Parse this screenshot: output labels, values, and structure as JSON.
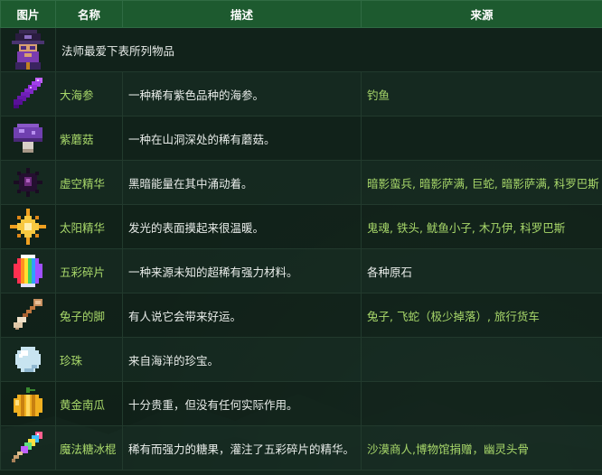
{
  "table": {
    "headers": {
      "image": "图片",
      "name": "名称",
      "description": "描述",
      "source": "来源"
    },
    "intro": {
      "icon": "wizard-portrait-icon",
      "text": "法师最爱下表所列物品"
    },
    "rows": [
      {
        "icon": "sea-cucumber-icon",
        "name": "大海参",
        "description": "一种稀有紫色品种的海参。",
        "source": "钓鱼"
      },
      {
        "icon": "purple-mushroom-icon",
        "name": "紫蘑菇",
        "description": "一种在山洞深处的稀有蘑菇。",
        "source": ""
      },
      {
        "icon": "void-essence-icon",
        "name": "虚空精华",
        "description": "黑暗能量在其中涌动着。",
        "source": "暗影蛮兵, 暗影萨满, 巨蛇, 暗影萨满, 科罗巴斯"
      },
      {
        "icon": "solar-essence-icon",
        "name": "太阳精华",
        "description": "发光的表面摸起来很温暖。",
        "source": "鬼魂, 铁头, 鱿鱼小子, 木乃伊, 科罗巴斯"
      },
      {
        "icon": "prismatic-shard-icon",
        "name": "五彩碎片",
        "description": "一种来源未知的超稀有强力材料。",
        "source": "各种原石",
        "source_plain": true
      },
      {
        "icon": "rabbits-foot-icon",
        "name": "兔子的脚",
        "description": "有人说它会带来好运。",
        "source": "兔子, 飞蛇（极少掉落）, 旅行货车"
      },
      {
        "icon": "pearl-icon",
        "name": "珍珠",
        "description": "来自海洋的珍宝。",
        "source": ""
      },
      {
        "icon": "golden-pumpkin-icon",
        "name": "黄金南瓜",
        "description": "十分贵重，但没有任何实际作用。",
        "source": ""
      },
      {
        "icon": "magic-rock-candy-icon",
        "name": "魔法糖冰棍",
        "description": "稀有而强力的糖果，灌注了五彩碎片的精华。",
        "source": "沙漠商人,博物馆捐赠，幽灵头骨"
      }
    ]
  }
}
